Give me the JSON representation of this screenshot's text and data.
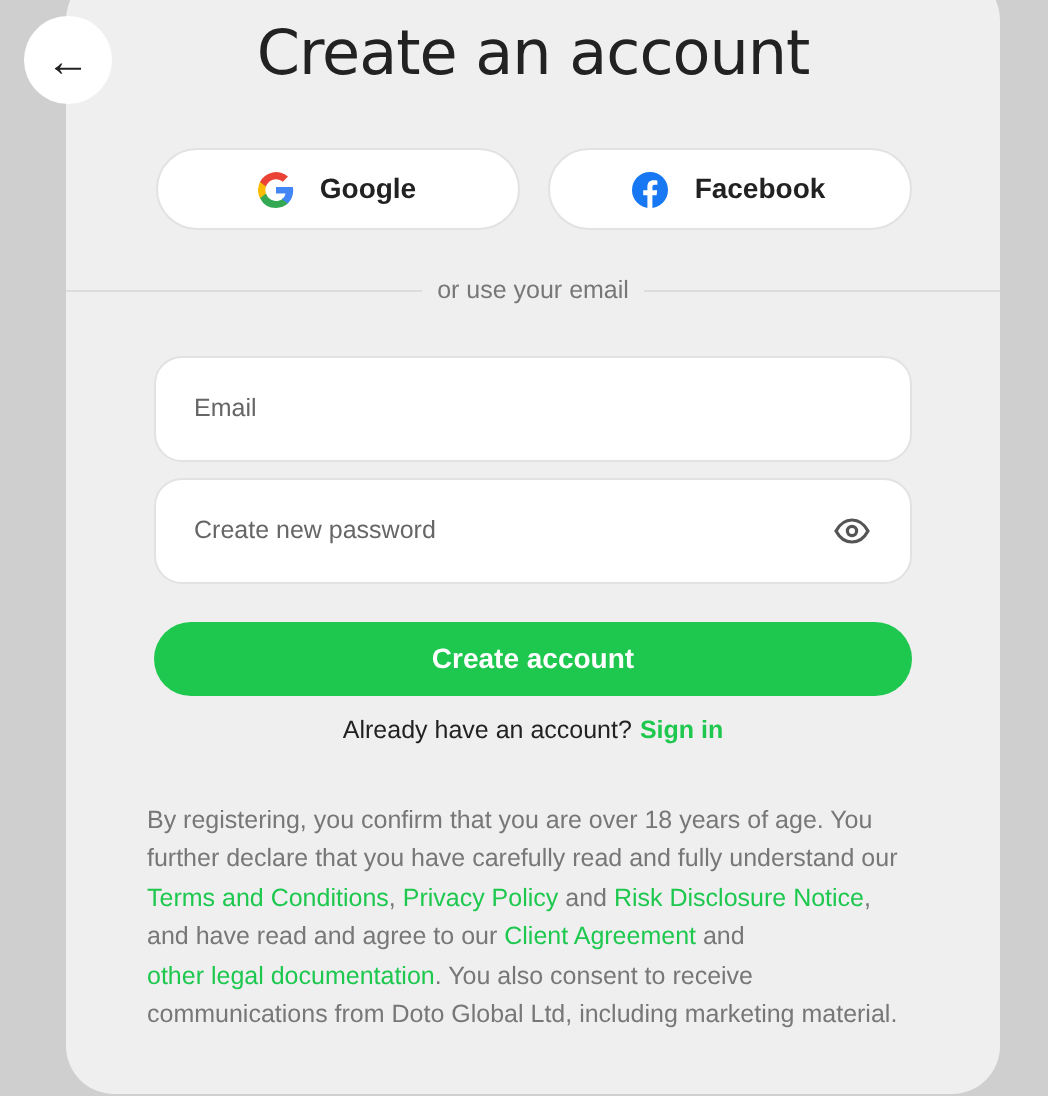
{
  "back_button": {
    "label": "←"
  },
  "title": "Create an account",
  "social_buttons": [
    {
      "kind": "google",
      "label": "Google"
    },
    {
      "kind": "facebook",
      "label": "Facebook"
    }
  ],
  "divider_text": "or use your email",
  "fields": [
    {
      "placeholder": "Email",
      "kind": "text"
    },
    {
      "placeholder": "Create new password",
      "kind": "password"
    }
  ],
  "submit_button": "Create account",
  "signin_prompt": {
    "text": "Already have an account?",
    "link": "Sign in"
  },
  "disclaimer": [
    {
      "kind": "text",
      "text": "By registering, you confirm that you are over 18 years of age. You further declare that you have carefully read and fully understand our "
    },
    {
      "kind": "link",
      "text": "Terms and Conditions"
    },
    {
      "kind": "text",
      "text": ", "
    },
    {
      "kind": "link",
      "text": "Privacy Policy"
    },
    {
      "kind": "text",
      "text": " and "
    },
    {
      "kind": "link",
      "text": "Risk Disclosure Notice"
    },
    {
      "kind": "text",
      "text": ", and have read and agree to our "
    },
    {
      "kind": "link",
      "text": "Client Agreement"
    },
    {
      "kind": "text",
      "text": " and "
    },
    {
      "kind": "link",
      "text": "other legal documentation"
    },
    {
      "kind": "text",
      "text": ". You also consent to receive communications from Doto Global Ltd, including marketing material."
    }
  ]
}
